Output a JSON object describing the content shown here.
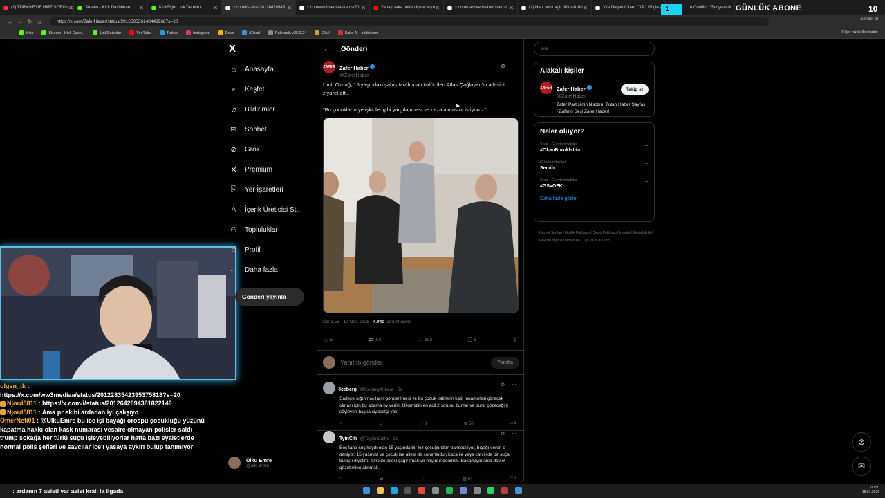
{
  "browser": {
    "tabs": [
      {
        "label": "(2) TÜRKİYE'DE HIRT SORUN",
        "color": "#e53935"
      },
      {
        "label": "Stream - Kick Dashboard",
        "color": "#53fc18"
      },
      {
        "label": "KickSight Link Detector",
        "color": "#53fc18"
      },
      {
        "label": "x.com/i/status/20126428943",
        "color": "#ffffff"
      },
      {
        "label": "x.com/ww3mediaa/status/20",
        "color": "#ffffff"
      },
      {
        "label": "Yapay zeka neden içme suyu",
        "color": "#ff0000"
      },
      {
        "label": "x.com/darkwebhaber/status/",
        "color": "#ffffff"
      },
      {
        "label": "(2) Hani şehit agit ölümsüzdü",
        "color": "#ffffff"
      },
      {
        "label": "X'te Doğan Cihan: \"YPJ Güçle",
        "color": "#ffffff"
      }
    ],
    "partial_tab": "e Conflict: \"Suriye ordu",
    "url": "https://x.com/ZaferHaber/status/2012505361404439687s=20",
    "chat_button": "Sohbet et",
    "bookmarks": [
      "Kick",
      "Stream - Kick Dash...",
      "LinkDetector",
      "YouTube",
      "Twitter",
      "Instagram",
      "Drive",
      "iCloud",
      "Paletools v26.0.24",
      "Okul",
      "Satın Al - obilet.com"
    ],
    "bookmark_colors": [
      "#53fc18",
      "#53fc18",
      "#53fc18",
      "#ff0000",
      "#1d9bf0",
      "#e1306c",
      "#f4b400",
      "#3a8ee6",
      "#888888",
      "#c9a227",
      "#d32f2f"
    ],
    "other_bookmarks": "Diğer sık kullanılanlar"
  },
  "overlay": {
    "badge_number": "1",
    "promo_text": "GÜNLÜK ABONE",
    "promo_number": "10"
  },
  "sidebar": {
    "logo": "X",
    "items": [
      {
        "label": "Anasayfa",
        "icon": "⌂"
      },
      {
        "label": "Keşfet",
        "icon": "⌕"
      },
      {
        "label": "Bildirimler",
        "icon": "♫"
      },
      {
        "label": "Sohbet",
        "icon": "✉"
      },
      {
        "label": "Grok",
        "icon": "⊘"
      },
      {
        "label": "Premium",
        "icon": "✕"
      },
      {
        "label": "Yer İşaretleri",
        "icon": "⎘"
      },
      {
        "label": "İçerik Üreticisi St...",
        "icon": "♙"
      },
      {
        "label": "Topluluklar",
        "icon": "⚇"
      },
      {
        "label": "Profil",
        "icon": "☺"
      },
      {
        "label": "Daha fazla",
        "icon": "⋯"
      }
    ],
    "post_button": "Gönderi yayınla",
    "profile": {
      "name": "Ülkü Emre",
      "handle": "@ulk_emre"
    }
  },
  "post": {
    "header": "Gönderi",
    "author": {
      "name": "Zafer Haber",
      "handle": "@ZaferHaber",
      "avatar_text": "ZAFER"
    },
    "text_1": "Ümit Özdağ, 15 yaşındaki şahıs tarafından öldürülen Atlas Çağlayan'ın ailesini ziyaret etti.",
    "text_2": "\"Bu çocukların yetişkinler gibi yargılanması ve ceza almasını istiyoruz.\"",
    "time": "ÖS 3:53 · 17 Oca 2026 · ",
    "views": "4.940",
    "views_label": " Görüntüleme",
    "stats": {
      "replies": "5",
      "reposts": "90",
      "likes": "683",
      "bookmarks": "5"
    },
    "reply_placeholder": "Yanıtını gönder",
    "reply_button": "Yanıtla"
  },
  "replies": [
    {
      "name": "Iceberg",
      "handle": "@IcebergAnkara · 6s",
      "text": "Sadece sığınmacıların gönderilmesi ve bu çocuk katillerin katil muamelesi görecek olması için bu adama oy verilir. Ülkemizin en acil 2 sorunu bunlar ve bunu çözeceğini söyleyen başka siyasetçi yok",
      "likes": "8",
      "views": "50",
      "avatar_color": "#9aa0a6"
    },
    {
      "name": "TyinCih",
      "handle": "@TaylanCulha · 3s",
      "text": "Beş tane suç kaydı olan 15 yaşında bir kız çocuğundan bahsediliyor, bıçağı veren o denlyor. 15 yaşında ve çocuk ise ailesi de sorumludur, kaza ile veya cahillikle bir suça bulaştı diyelim, ikincide ailesi çağırılmalı ve hayırdır denmeli. Bakamıyorlarsa devlet gözetimine alınmalı.",
      "likes": "",
      "views": "54",
      "avatar_color": "#c7c7c7"
    }
  ],
  "right": {
    "search_placeholder": "Ara",
    "related_title": "Alakalı kişiler",
    "related": {
      "name": "Zafer Haber",
      "handle": "@ZaferHaber",
      "bio": "Zafer Partisi'nin Nabzını Tutan Haber Sayfası | Zaferin Sesi Zafer Haber!",
      "follow": "Takip et"
    },
    "trending_title": "Neler oluyor?",
    "trends": [
      {
        "category": "Spor · Gündemdekiler",
        "title": "#OkanBurukİstifa"
      },
      {
        "category": "Gündemdekiler",
        "title": "Semih"
      },
      {
        "category": "Spor · Gündemdekiler",
        "title": "#GSvGFK"
      }
    ],
    "more": "Daha fazla göster",
    "footer": [
      "Hizmet Şartları",
      "Gizlilik Politikası",
      "Çerez Politikası",
      "Imprint",
      "Erişilebilirlik",
      "Reklam bilgisi",
      "Daha fazla ...",
      "© 2026 X Corp."
    ]
  },
  "chat": [
    {
      "user": "ulgen_tk",
      "message": ":",
      "badge": false
    },
    {
      "user": "",
      "message": "https://x.com/ww3mediaa/status/2012283542395375818?s=20",
      "badge": false
    },
    {
      "user": "Njord5811",
      "message": ": https://x.com/i/status/2012642894381822149",
      "badge": true
    },
    {
      "user": "Njord5811",
      "message": ": Ama pr ekibi ardadan iyi çalışıyo",
      "badge": true
    },
    {
      "user": "OmerNefi01",
      "message": ": @UlkuEmre bu ice işi bayağı orospu çocukluğu yüzünü kapatma hakkı olan kask numarası vesaire olmayan polisler saldı trump sokağa her türlü suçu işleyebiliyorlar hatta bazı eyaletlerde normal polis şefleri ve savcılar ice'ı yasaya aykırı bulup tanımıyor",
      "badge": false
    }
  ],
  "bottom_chat": ": ardanın 7 asisti var asist kralı la ligada",
  "taskbar": {
    "time": "00:50",
    "date": "18.01.2026"
  }
}
